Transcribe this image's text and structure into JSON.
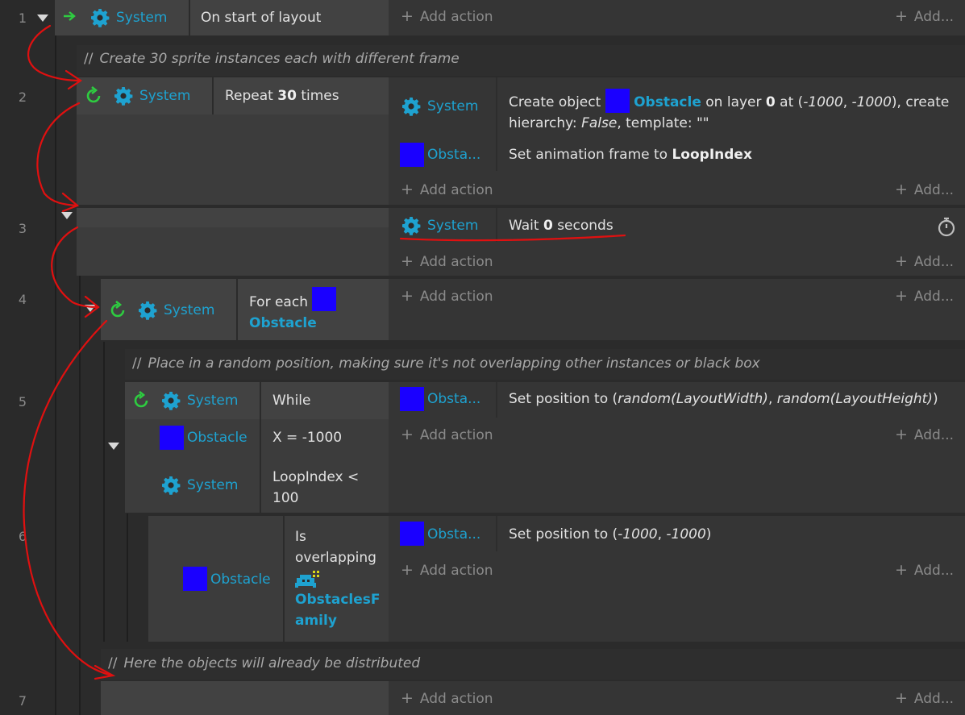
{
  "rows": [
    "1",
    "2",
    "3",
    "4",
    "5",
    "6",
    "7"
  ],
  "common": {
    "system": "System",
    "add_action": "Add action",
    "add_short": "Add...",
    "obstacle": "Obstacle",
    "obsta_short": "Obsta..."
  },
  "e1": {
    "condition": "On start of layout"
  },
  "c1": {
    "text": "Create 30 sprite instances each with different frame"
  },
  "e2": {
    "cond_pre": "Repeat",
    "cond_num": "30",
    "cond_post": "times",
    "a1_l1_pre": "Create object",
    "a1_obj": "Obstacle",
    "a1_l1_mid": "on layer",
    "a1_layer": "0",
    "a1_at": "at (",
    "a1_x": "-1000",
    "a1_comma": ", ",
    "a1_y": "-1000",
    "a1_l1_end": "), create",
    "a1_l2_pre": "hierarchy:",
    "a1_false": "False",
    "a1_l2_post": ", template: \"\"",
    "a2_pre": "Set animation frame to",
    "a2_val": "LoopIndex"
  },
  "e3": {
    "pre": "Wait",
    "num": "0",
    "post": "seconds"
  },
  "e4": {
    "pre": "For each",
    "obj": "Obstacle"
  },
  "c2": {
    "text": "Place in a random position, making sure it's not overlapping other instances or black box"
  },
  "e5": {
    "c1": "While",
    "c2": "X = -1000",
    "c3_l1": "LoopIndex <",
    "c3_l2": "100",
    "a_pre": "Set position to (",
    "a_x": "random(LayoutWidth)",
    "a_comma": ", ",
    "a_y": "random(LayoutHeight)",
    "a_end": ")"
  },
  "e6": {
    "c_l1": "Is",
    "c_l2": "overlapping",
    "fam_l1": "ObstaclesF",
    "fam_l2": "amily",
    "a_pre": "Set position to (",
    "a_x": "-1000",
    "a_comma": ", ",
    "a_y": "-1000",
    "a_end": ")"
  },
  "c3": {
    "text": "Here the objects will already be distributed"
  },
  "colors": {
    "accent": "#1ea2d0",
    "object": "#1a00ff",
    "annotation": "#e01010",
    "trigger": "#2ecc40"
  }
}
